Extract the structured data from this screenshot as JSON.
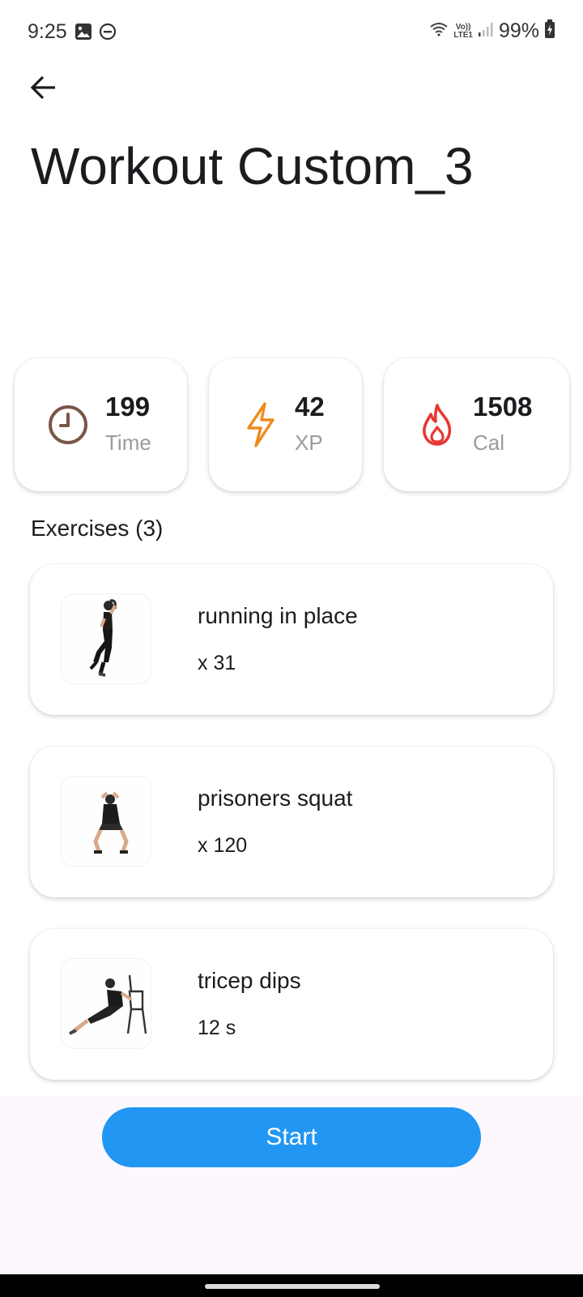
{
  "status_bar": {
    "time": "9:25",
    "network_type": "LTE1",
    "volte": "Vo))",
    "battery": "99%"
  },
  "header": {
    "back_icon": "arrow-left-icon",
    "title": "Workout Custom_3"
  },
  "stats": [
    {
      "icon": "clock-icon",
      "value": "199",
      "label": "Time",
      "color": "#7a5548"
    },
    {
      "icon": "lightning-icon",
      "value": "42",
      "label": "XP",
      "color": "#f08a1c"
    },
    {
      "icon": "fire-icon",
      "value": "1508",
      "label": "Cal",
      "color": "#e53935"
    }
  ],
  "exercises_title": "Exercises (3)",
  "exercises": [
    {
      "name": "running in place",
      "amount": "x 31"
    },
    {
      "name": "prisoners squat",
      "amount": "x 120"
    },
    {
      "name": "tricep dips",
      "amount": "12 s"
    }
  ],
  "start_label": "Start",
  "colors": {
    "accent": "#2196f3",
    "bottom_bg": "#fdf8fd"
  }
}
